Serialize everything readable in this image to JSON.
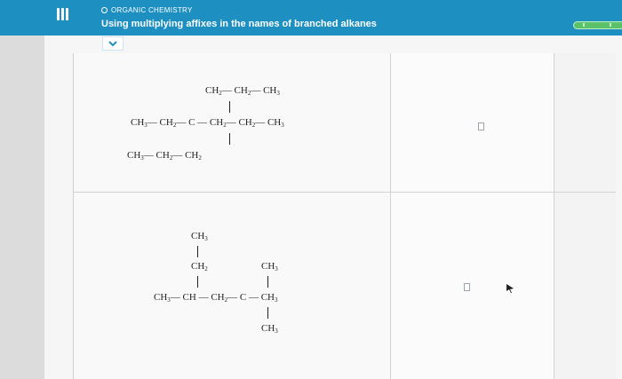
{
  "header": {
    "topic": "ORGANIC CHEMISTRY",
    "title": "Using multiplying affixes in the names of branched alkanes",
    "menu_icon": "hamburger-icon",
    "progress_icon": "progress-bar",
    "accent_color": "#1d8fc1"
  },
  "collapse": {
    "icon": "chevron-down-icon"
  },
  "molecules": [
    {
      "top_branch": [
        "CH",
        "2",
        "CH",
        "2",
        "CH",
        "3"
      ],
      "main_chain": [
        "CH",
        "3",
        "CH",
        "2",
        "C",
        "CH",
        "2",
        "CH",
        "2",
        "CH",
        "3"
      ],
      "bottom_branch": [
        "CH",
        "3",
        "CH",
        "2",
        "CH",
        "2"
      ],
      "answer": ""
    },
    {
      "top_methyl": [
        "CH",
        "3"
      ],
      "top_ch2": [
        "CH",
        "2"
      ],
      "right_methyl": [
        "CH",
        "3"
      ],
      "main_chain": [
        "CH",
        "3",
        "CH",
        "CH",
        "2",
        "C",
        "CH",
        "3"
      ],
      "bottom_methyl": [
        "CH",
        "3"
      ],
      "answer": ""
    }
  ]
}
